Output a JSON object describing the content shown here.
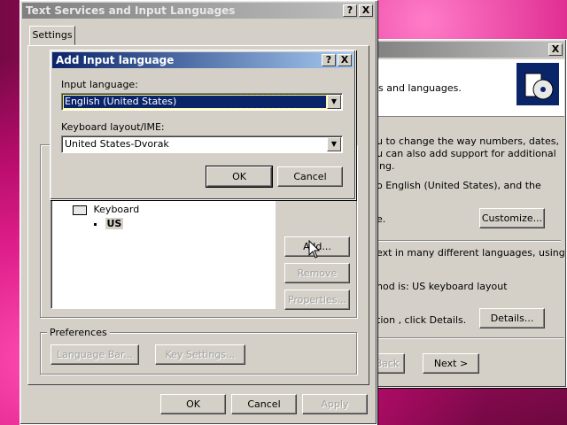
{
  "regional": {
    "text1": "s and languages.",
    "text2": "u to change the way numbers, dates,",
    "text3": "u can also add support for additional",
    "text4": "ing.",
    "text5": "o English (United States), and the",
    "text6": "e.",
    "customize_label": "Customize...",
    "text7": "ext in many different languages, using",
    "text8": "hod is: US keyboard layout",
    "text9": "tion , click Details.",
    "details_label": "Details...",
    "back_label": "Back",
    "next_label": "Next >"
  },
  "text_services": {
    "title": "Text Services and Input Languages",
    "tab_settings": "Settings",
    "tree_keyboard": "Keyboard",
    "tree_us": "US",
    "add_label": "Add...",
    "remove_label": "Remove",
    "properties_label": "Properties...",
    "preferences_label": "Preferences",
    "language_bar_label": "Language Bar...",
    "key_settings_label": "Key Settings...",
    "ok_label": "OK",
    "cancel_label": "Cancel",
    "apply_label": "Apply"
  },
  "add_input": {
    "title": "Add Input language",
    "input_language_label": "Input language:",
    "input_language_value": "English (United States)",
    "keyboard_layout_label": "Keyboard layout/IME:",
    "keyboard_layout_value": "United States-Dvorak",
    "ok_label": "OK",
    "cancel_label": "Cancel"
  },
  "title_buttons": {
    "help": "?",
    "close": "X"
  },
  "dropdown_arrow": "▼"
}
